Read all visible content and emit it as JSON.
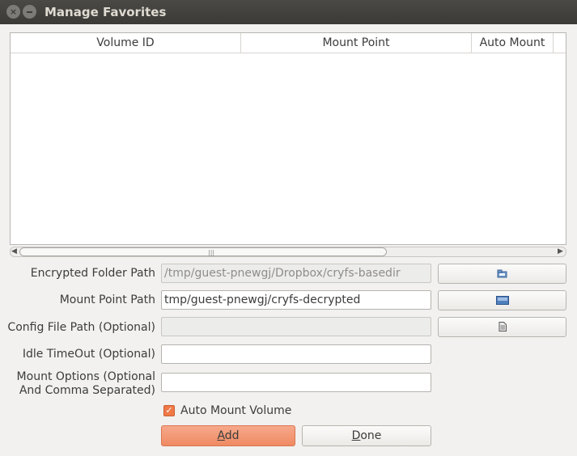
{
  "window": {
    "title": "Manage Favorites",
    "close_glyph": "×"
  },
  "table": {
    "columns": [
      "Volume ID",
      "Mount Point",
      "Auto Mount"
    ],
    "rows": [],
    "scrollbar": {
      "left_arrow": "◀",
      "right_arrow": "▶",
      "grip": "|||"
    }
  },
  "form": {
    "encrypted_folder": {
      "label": "Encrypted Folder Path",
      "value": "/tmp/guest-pnewgj/Dropbox/cryfs-basedir",
      "disabled": true
    },
    "mount_point": {
      "label": "Mount Point Path",
      "value": "tmp/guest-pnewgj/cryfs-decrypted"
    },
    "config_file": {
      "label": "Config File Path (Optional)",
      "value": "",
      "disabled": true
    },
    "idle_timeout": {
      "label": "Idle TimeOut (Optional)",
      "value": ""
    },
    "mount_options": {
      "label_line1": "Mount Options (Optional",
      "label_line2": "And Comma Separated)",
      "value": ""
    },
    "auto_mount": {
      "label": "Auto Mount Volume",
      "checked": true,
      "check_glyph": "✓"
    }
  },
  "buttons": {
    "add": {
      "mnemonic": "A",
      "rest": "dd"
    },
    "done": {
      "mnemonic": "D",
      "rest": "one"
    }
  },
  "icons": [
    "folder-icon",
    "drive-icon",
    "file-icon"
  ]
}
